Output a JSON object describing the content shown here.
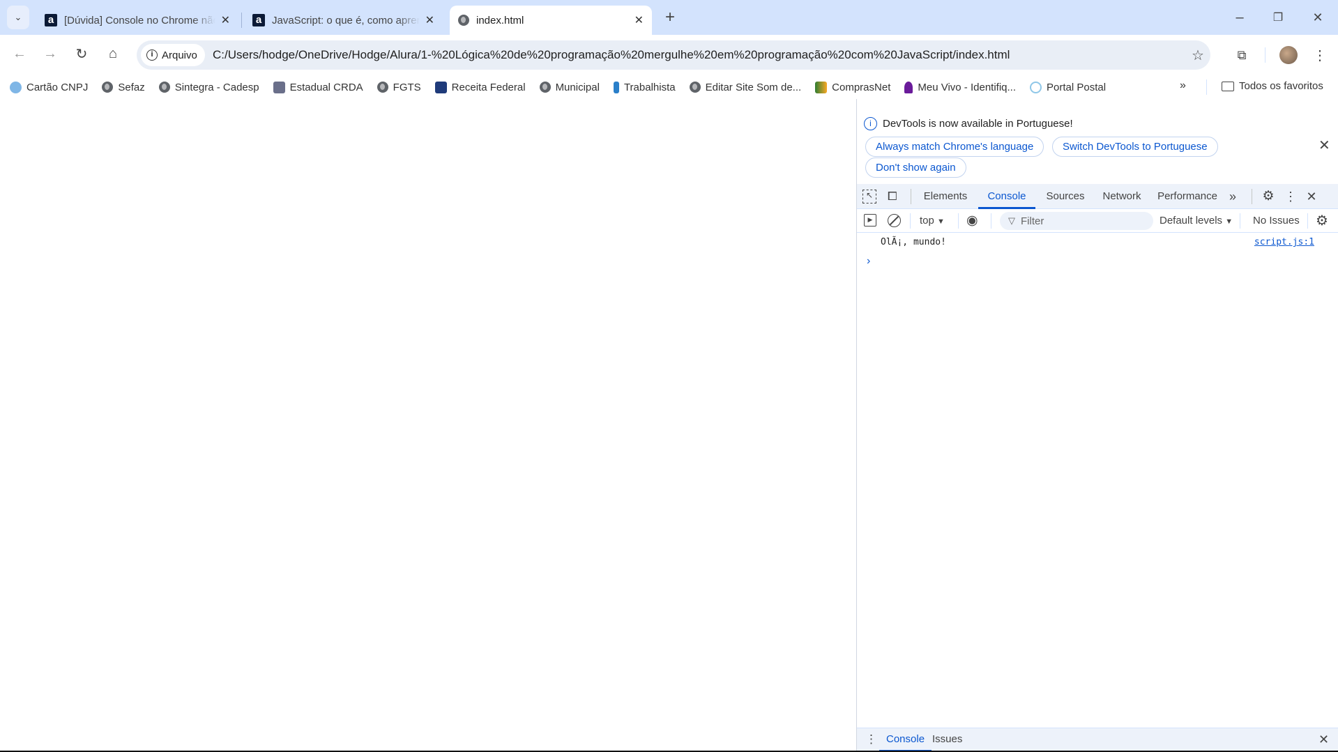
{
  "tabs": [
    {
      "title": "[Dúvida] Console no Chrome não",
      "icon": "alura-icon"
    },
    {
      "title": "JavaScript: o que é, como aprender",
      "icon": "alura-icon"
    },
    {
      "title": "index.html",
      "icon": "globe-icon",
      "active": true
    }
  ],
  "omnibox": {
    "chip": "Arquivo",
    "url": "C:/Users/hodge/OneDrive/Hodge/Alura/1-%20Lógica%20de%20programação%20mergulhe%20em%20programação%20com%20JavaScript/index.html"
  },
  "bookmarks": [
    {
      "label": "Cartão CNPJ",
      "color": "#7fb6e6"
    },
    {
      "label": "Sefaz",
      "color": "#5f6368"
    },
    {
      "label": "Sintegra - Cadesp",
      "color": "#5f6368"
    },
    {
      "label": "Estadual CRDA",
      "color": "#6a6f8a"
    },
    {
      "label": "FGTS",
      "color": "#5f6368"
    },
    {
      "label": "Receita Federal",
      "color": "#1f3b7a"
    },
    {
      "label": "Municipal",
      "color": "#5f6368"
    },
    {
      "label": "Trabalhista",
      "color": "#2a7fc9"
    },
    {
      "label": "Editar Site Som de...",
      "color": "#5f6368"
    },
    {
      "label": "ComprasNet",
      "color": "#2e7d32"
    },
    {
      "label": "Meu Vivo - Identifiq...",
      "color": "#6a1b9a"
    },
    {
      "label": "Portal Postal",
      "color": "#8fc7e8"
    }
  ],
  "all_bookmarks": "Todos os favoritos",
  "devtools": {
    "banner": {
      "text": "DevTools is now available in Portuguese!",
      "buttons": [
        "Always match Chrome's language",
        "Switch DevTools to Portuguese",
        "Don't show again"
      ]
    },
    "tabs": [
      "Elements",
      "Console",
      "Sources",
      "Network",
      "Performance"
    ],
    "active_tab": "Console",
    "toolbar": {
      "context": "top",
      "filter_placeholder": "Filter",
      "levels": "Default levels",
      "issues": "No Issues"
    },
    "messages": [
      {
        "text": "OlÃ¡, mundo!",
        "source": "script.js:1"
      }
    ],
    "drawer_tabs": [
      "Console",
      "Issues"
    ]
  },
  "colors": {
    "accent": "#0b57d0",
    "tabstrip": "#d3e3fd"
  }
}
